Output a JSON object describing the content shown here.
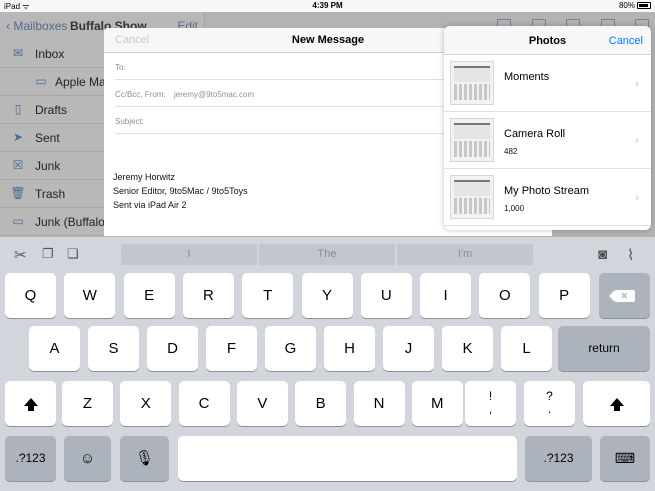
{
  "status": {
    "left": "iPad ᯤ",
    "time": "4:39 PM",
    "battery": "80%"
  },
  "mailboxes": {
    "back_label": "Mailboxes",
    "title": "Buffalo Show",
    "edit_label": "Edit",
    "items": [
      {
        "label": "Inbox",
        "icon": "inbox-icon",
        "glyph": "✉",
        "sub": false
      },
      {
        "label": "Apple Mail",
        "icon": "folder-icon",
        "glyph": "▭",
        "sub": true
      },
      {
        "label": "Drafts",
        "icon": "drafts-icon",
        "glyph": "▯",
        "sub": false
      },
      {
        "label": "Sent",
        "icon": "sent-icon",
        "glyph": "➤",
        "sub": false
      },
      {
        "label": "Junk",
        "icon": "junk-icon",
        "glyph": "☒",
        "sub": false
      },
      {
        "label": "Trash",
        "icon": "trash-icon",
        "glyph": "🗑",
        "sub": false
      },
      {
        "label": "Junk (Buffalo",
        "icon": "folder-icon",
        "glyph": "▭",
        "sub": false
      }
    ]
  },
  "compose": {
    "cancel_label": "Cancel",
    "title": "New Message",
    "to_label": "To:",
    "ccbcc_label": "Cc/Bcc, From:",
    "from_value": "jeremy@9to5mac.com",
    "subject_label": "Subject:",
    "signature": [
      "Jeremy Horwitz",
      "Senior Editor, 9to5Mac / 9to5Toys",
      "Sent via iPad Air 2"
    ]
  },
  "photos": {
    "title": "Photos",
    "cancel_label": "Cancel",
    "albums": [
      {
        "name": "Moments",
        "count": ""
      },
      {
        "name": "Camera Roll",
        "count": "482"
      },
      {
        "name": "My Photo Stream",
        "count": "1,000"
      }
    ]
  },
  "predictions": [
    "I",
    "The",
    "I'm"
  ],
  "keyboard": {
    "row1": [
      "Q",
      "W",
      "E",
      "R",
      "T",
      "Y",
      "U",
      "I",
      "O",
      "P"
    ],
    "row2": [
      "A",
      "S",
      "D",
      "F",
      "G",
      "H",
      "J",
      "K",
      "L"
    ],
    "row3": [
      "Z",
      "X",
      "C",
      "V",
      "B",
      "N",
      "M"
    ],
    "return_label": "return",
    "numbers_label": ".?123",
    "punct1": [
      "!",
      ","
    ],
    "punct2": [
      "?",
      "."
    ]
  }
}
